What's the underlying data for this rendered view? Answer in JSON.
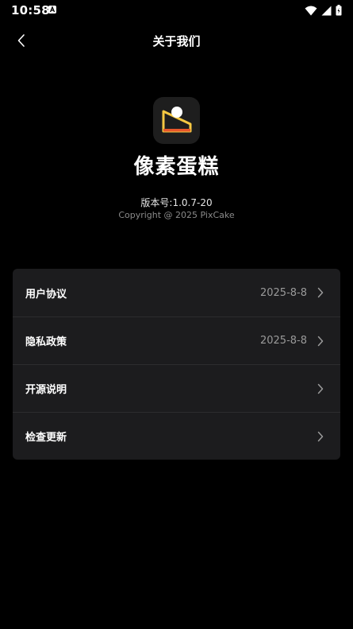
{
  "status_bar": {
    "time": "10:58",
    "icons": [
      "notification-a-icon",
      "wifi-icon",
      "cell-signal-icon",
      "battery-icon"
    ]
  },
  "header": {
    "title": "关于我们",
    "back_icon": "chevron-left-icon"
  },
  "app": {
    "logo_icon": "pixcake-logo-icon",
    "name": "像素蛋糕",
    "version": "版本号:1.0.7-20",
    "copyright": "Copyright @ 2025 PixCake"
  },
  "settings": {
    "items": [
      {
        "label": "用户协议",
        "value": "2025-8-8"
      },
      {
        "label": "隐私政策",
        "value": "2025-8-8"
      },
      {
        "label": "开源说明",
        "value": ""
      },
      {
        "label": "检查更新",
        "value": ""
      }
    ]
  },
  "colors": {
    "background": "#000000",
    "card": "#1c1c1e",
    "logo_yellow": "#f5c842",
    "logo_orange": "#e8562a",
    "secondary_text": "#9a9a9a"
  }
}
